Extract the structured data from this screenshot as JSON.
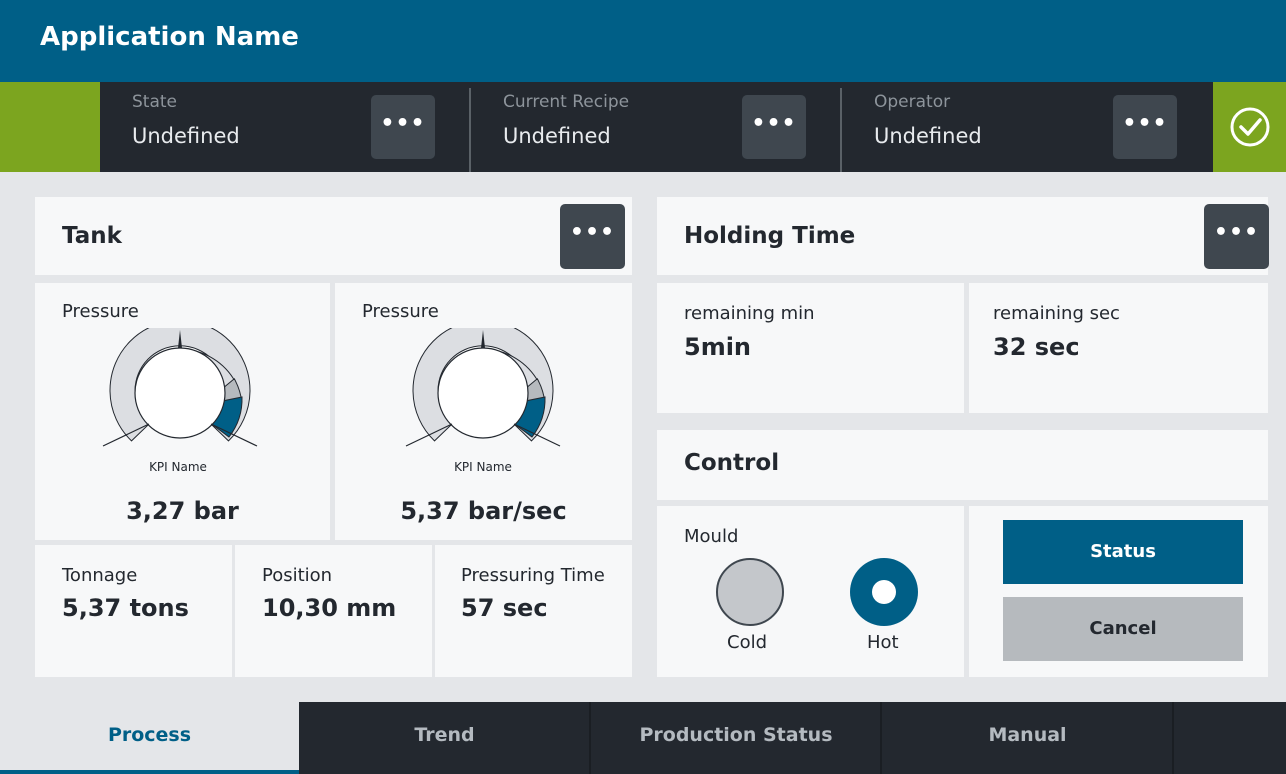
{
  "app": {
    "title": "Application Name"
  },
  "status_bar": {
    "items": [
      {
        "label": "State",
        "value": "Undefined",
        "menu_label": "•••"
      },
      {
        "label": "Current Recipe",
        "value": "Undefined",
        "menu_label": "•••"
      },
      {
        "label": "Operator",
        "value": "Undefined",
        "menu_label": "•••"
      }
    ],
    "status_icon": "check-circle-icon",
    "accent_color": "#7ca51f"
  },
  "tank": {
    "title": "Tank",
    "menu_label": "•••",
    "gauges": [
      {
        "label": "Pressure",
        "kpi_name": "KPI Name",
        "value": "3,27 bar"
      },
      {
        "label": "Pressure",
        "kpi_name": "KPI Name",
        "value": "5,37 bar/sec"
      }
    ],
    "metrics": [
      {
        "label": "Tonnage",
        "value": "5,37 tons"
      },
      {
        "label": "Position",
        "value": "10,30 mm"
      },
      {
        "label": "Pressuring Time",
        "value": "57 sec"
      }
    ]
  },
  "holding_time": {
    "title": "Holding Time",
    "menu_label": "•••",
    "remaining_min": {
      "label": "remaining min",
      "value": "5min"
    },
    "remaining_sec": {
      "label": "remaining sec",
      "value": "32 sec"
    }
  },
  "control": {
    "title": "Control",
    "mould": {
      "label": "Mould",
      "options": [
        {
          "label": "Cold",
          "selected": false
        },
        {
          "label": "Hot",
          "selected": true
        }
      ]
    },
    "status_button": "Status",
    "cancel_button": "Cancel"
  },
  "tabs": [
    {
      "label": "Process",
      "active": true
    },
    {
      "label": "Trend",
      "active": false
    },
    {
      "label": "Production Status",
      "active": false
    },
    {
      "label": "Manual",
      "active": false
    }
  ],
  "colors": {
    "primary": "#005f87",
    "dark": "#23282f",
    "button_dark": "#3f474f",
    "success": "#7ca51f"
  }
}
